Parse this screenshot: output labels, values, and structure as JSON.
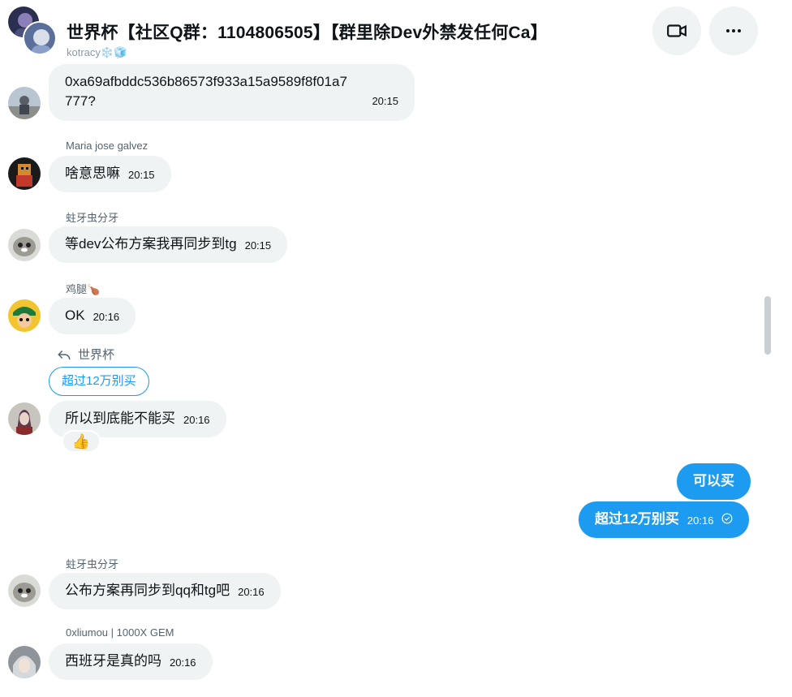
{
  "header": {
    "title": "世界杯【社区Q群：1104806505】【群里除Dev外禁发任何Ca】",
    "video_icon": "video-camera-icon",
    "more_icon": "more-horizontal-icon"
  },
  "top_sender": "kotracy❄️🧊",
  "messages": [
    {
      "id": "m1",
      "text_line1": "0xa69afbddc536b86573f933a15a9589f8f01a7",
      "text_line2": "777?",
      "time": "20:15"
    },
    {
      "id": "m2",
      "sender": "Maria jose galvez",
      "text": "啥意思嘛",
      "time": "20:15"
    },
    {
      "id": "m3",
      "sender": "蛀牙虫分牙",
      "text": "等dev公布方案我再同步到tg",
      "time": "20:15"
    },
    {
      "id": "m4",
      "sender": "鸡腿🍗",
      "text": "OK",
      "time": "20:16"
    },
    {
      "id": "m5",
      "reply_to": "世界杯",
      "quoted": "超过12万别买",
      "text": "所以到底能不能买",
      "time": "20:16",
      "reaction": "👍"
    },
    {
      "id": "m6",
      "text": "可以买"
    },
    {
      "id": "m7",
      "text": "超过12万别买",
      "time": "20:16"
    },
    {
      "id": "m8",
      "sender": "蛀牙虫分牙",
      "text": "公布方案再同步到qq和tg吧",
      "time": "20:16"
    },
    {
      "id": "m9",
      "sender": "0xliumou | 1000X GEM",
      "text": "西班牙是真的吗",
      "time": "20:16"
    }
  ]
}
